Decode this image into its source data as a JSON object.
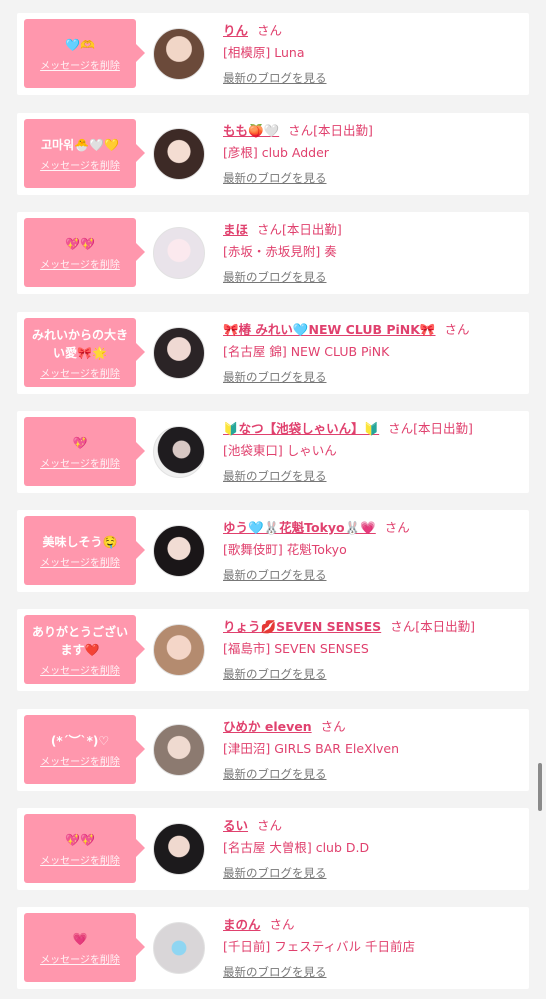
{
  "delete_label": "メッセージを削除",
  "blog_label": "最新のブログを見る",
  "san_label": "さん",
  "colors": {
    "bubble": "#ff97ad",
    "accent": "#e0416e",
    "card": "#ffffff",
    "background": "#f3f3f3"
  },
  "items": [
    {
      "message": "🩵🫶",
      "name": "りん",
      "on_duty": "",
      "location": "[相模原] Luna",
      "avatar_icon": "girl-photo"
    },
    {
      "message": "고마워🐣🤍💛",
      "name": "もも🍑🤍",
      "on_duty": "[本日出勤]",
      "location": "[彦根] club Adder",
      "avatar_icon": "girl-photo"
    },
    {
      "message": "💖💖",
      "name": "まほ",
      "on_duty": "[本日出勤]",
      "location": "[赤坂・赤坂見附] 奏",
      "avatar_icon": "girl-photo"
    },
    {
      "message": "みれいからの大きい愛🎀🌟",
      "name": "🎀椿 みれい🩵NEW CLUB PiNK🎀",
      "on_duty": "",
      "location": "[名古屋 錦] NEW CLUB PiNK",
      "avatar_icon": "girl-photo"
    },
    {
      "message": "💖",
      "name": "🔰なつ【池袋しゃいん】🔰",
      "on_duty": "[本日出勤]",
      "location": "[池袋東口] しゃいん",
      "avatar_icon": "girl-photo"
    },
    {
      "message": "美味しそう🤤",
      "name": "ゆう🩵🐰花魁Tokyo🐰💗",
      "on_duty": "",
      "location": "[歌舞伎町] 花魁Tokyo",
      "avatar_icon": "girl-photo"
    },
    {
      "message": "ありがとうございます❤️",
      "name": "りょう💋SEVEN SENSES",
      "on_duty": "[本日出勤]",
      "location": "[福島市] SEVEN SENSES",
      "avatar_icon": "girl-photo"
    },
    {
      "message": "(*´︶`*)♡",
      "name": "ひめか eleven",
      "on_duty": "",
      "location": "[津田沼] GIRLS BAR EleXlven",
      "avatar_icon": "girl-photo"
    },
    {
      "message": "💖💖",
      "name": "るい",
      "on_duty": "",
      "location": "[名古屋 大曽根] club D.D",
      "avatar_icon": "girl-photo"
    },
    {
      "message": "💗",
      "name": "まのん",
      "on_duty": "",
      "location": "[千日前] フェスティバル 千日前店",
      "avatar_icon": "girl-photo"
    }
  ]
}
